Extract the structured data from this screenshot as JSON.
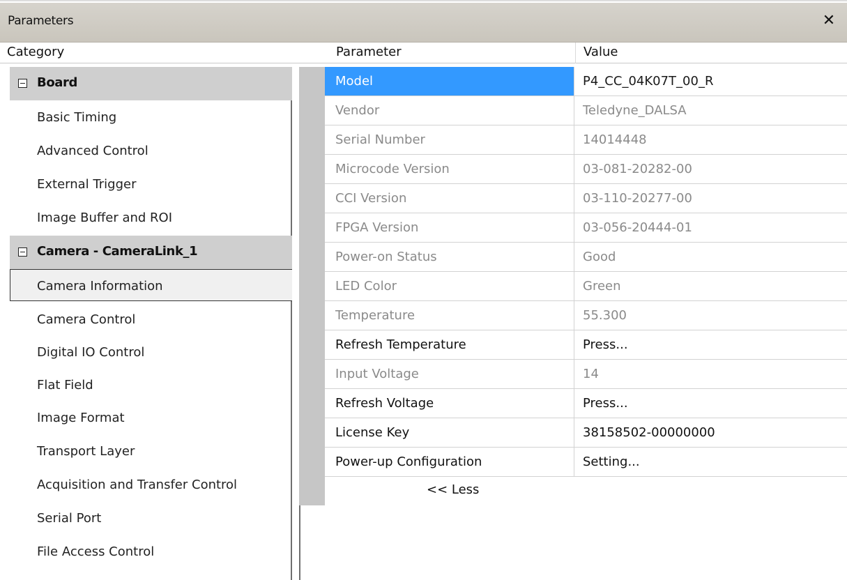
{
  "window": {
    "title": "Parameters",
    "close_label": "✕"
  },
  "headers": {
    "category": "Category",
    "parameter": "Parameter",
    "value": "Value"
  },
  "categories": {
    "board": {
      "label": "Board",
      "items": [
        "Basic Timing",
        "Advanced Control",
        "External Trigger",
        "Image Buffer and ROI"
      ]
    },
    "camera": {
      "label": "Camera - CameraLink_1",
      "items": [
        "Camera Information",
        "Camera Control",
        "Digital IO Control",
        "Flat Field",
        "Image Format",
        "Transport Layer",
        "Acquisition and Transfer Control",
        "Serial Port",
        "File Access Control"
      ],
      "selected": "Camera Information"
    }
  },
  "parameters": [
    {
      "name": "Model",
      "value": "P4_CC_04K07T_00_R",
      "state": "selected"
    },
    {
      "name": "Vendor",
      "value": "Teledyne_DALSA",
      "state": "readonly"
    },
    {
      "name": "Serial Number",
      "value": "14014448",
      "state": "readonly"
    },
    {
      "name": "Microcode Version",
      "value": "03-081-20282-00",
      "state": "readonly"
    },
    {
      "name": "CCI Version",
      "value": "03-110-20277-00",
      "state": "readonly"
    },
    {
      "name": "FPGA Version",
      "value": "03-056-20444-01",
      "state": "readonly"
    },
    {
      "name": "Power-on Status",
      "value": "Good",
      "state": "readonly"
    },
    {
      "name": "LED Color",
      "value": "Green",
      "state": "readonly"
    },
    {
      "name": "Temperature",
      "value": "55.300",
      "state": "readonly"
    },
    {
      "name": "Refresh Temperature",
      "value": "Press...",
      "state": "editable"
    },
    {
      "name": "Input Voltage",
      "value": "14",
      "state": "readonly"
    },
    {
      "name": "Refresh Voltage",
      "value": "Press...",
      "state": "editable"
    },
    {
      "name": "License Key",
      "value": "38158502-00000000",
      "state": "editable"
    },
    {
      "name": "Power-up Configuration",
      "value": "Setting...",
      "state": "editable"
    }
  ],
  "less_label": "<< Less",
  "colors": {
    "selection": "#3399ff",
    "group_header": "#cfcfcf",
    "readonly_text": "#8a8a8a"
  }
}
